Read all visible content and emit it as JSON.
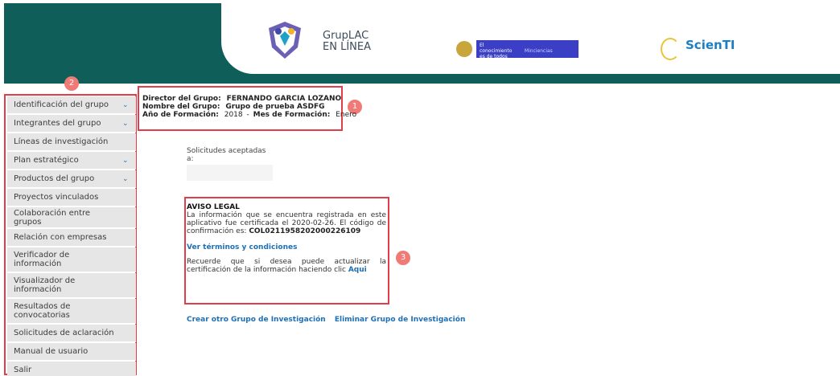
{
  "header": {
    "app_title_line1": "GrupLAC",
    "app_title_line2": "EN LÍNEA",
    "gov_text": "El conocimiento es de todos",
    "gov_ministry": "Minciencias",
    "scienti_title": "ScienTI",
    "brand_color": "#0f5e5a"
  },
  "sidebar": {
    "badge": "2",
    "items": [
      {
        "label": "Identificación del grupo",
        "expandable": true
      },
      {
        "label": "Integrantes del grupo",
        "expandable": true
      },
      {
        "label": "Líneas de investigación",
        "expandable": false
      },
      {
        "label": "Plan estratégico",
        "expandable": true
      },
      {
        "label": "Productos del grupo",
        "expandable": true
      },
      {
        "label": "Proyectos vinculados",
        "expandable": false
      },
      {
        "label": "Colaboración entre grupos",
        "expandable": false
      },
      {
        "label": "Relación con empresas",
        "expandable": false
      },
      {
        "label": "Verificador de información",
        "expandable": false
      },
      {
        "label": "Visualizador de información",
        "expandable": false
      },
      {
        "label": "Resultados de convocatorias",
        "expandable": false
      },
      {
        "label": "Solicitudes de aclaración",
        "expandable": false
      },
      {
        "label": "Manual de usuario",
        "expandable": false
      },
      {
        "label": "Salir",
        "expandable": false
      }
    ]
  },
  "group_info": {
    "badge": "1",
    "director_label": "Director del Grupo:",
    "director_value": "FERNANDO GARCIA LOZANO",
    "name_label": "Nombre del Grupo:",
    "name_value": "Grupo de prueba ASDFG",
    "year_label": "Año de Formación:",
    "year_value": "2018",
    "separator": "-",
    "month_label": "Mes de Formación:",
    "month_value": "Enero"
  },
  "accepted": {
    "label": "Solicitudes aceptadas a:"
  },
  "aviso": {
    "badge": "3",
    "title": "AVISO LEGAL",
    "text1": "La información que se encuentra registrada en este aplicativo fue certificada el 2020-02-26. El código de confirmación es:",
    "code": "COL0211958202000226109",
    "terms_link": "Ver términos y condiciones",
    "text2": "Recuerde que si desea puede actualizar la certificación de la información haciendo clic",
    "here_link": "Aqui"
  },
  "actions": {
    "create": "Crear otro Grupo de Investigación",
    "delete": "Eliminar Grupo de Investigación"
  },
  "colors": {
    "highlight": "#e23d4b",
    "badge": "#f07b76",
    "link": "#1d6fb8"
  }
}
